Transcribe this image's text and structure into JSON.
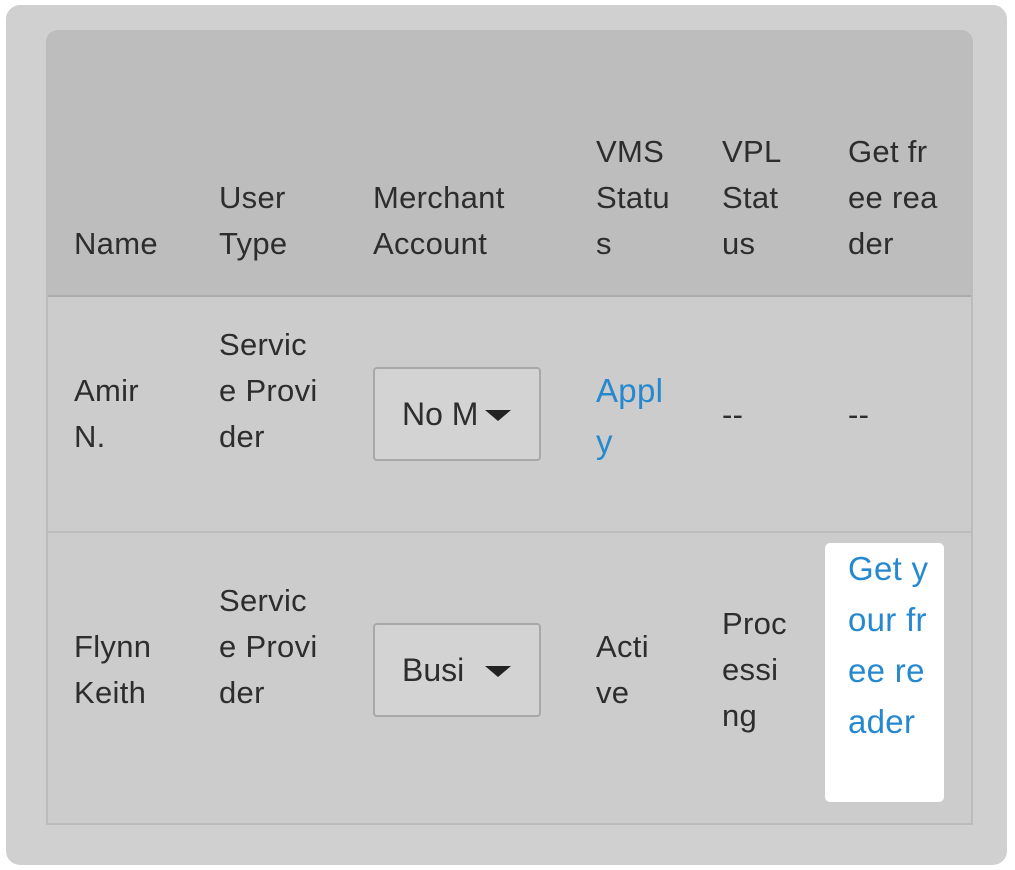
{
  "table": {
    "headers": {
      "name": "Name",
      "user_type": "User Type",
      "merchant_account": "Merchant Account",
      "vms_status": "VMS Status",
      "vpl_status": "VPL Status",
      "get_free_reader": "Get free reader"
    },
    "rows": [
      {
        "name": "Amir N.",
        "user_type": "Service Provider",
        "merchant_account": "No M",
        "vms_status": "Apply",
        "vpl_status": "--",
        "get_free_reader": "--"
      },
      {
        "name": "Flynn Keith",
        "user_type": "Service Provider",
        "merchant_account": "Busi",
        "vms_status": "Active",
        "vpl_status": "Processing",
        "get_free_reader": "Get your free reader"
      }
    ]
  },
  "colors": {
    "link": "#2688cf",
    "header_bg": "#bdbdbd",
    "row_bg": "#cccccc",
    "highlight_bg": "#ffffff"
  },
  "icons": {
    "dropdown": "caret-down-icon"
  }
}
